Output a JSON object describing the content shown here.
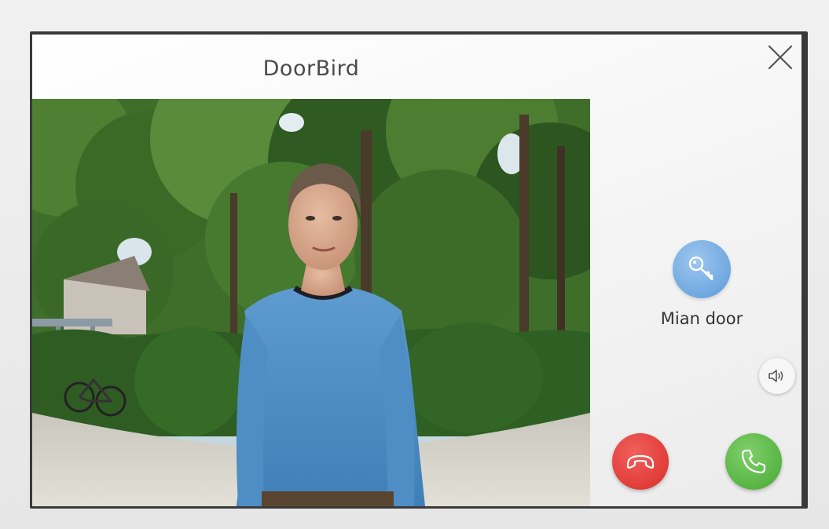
{
  "header": {
    "title": "DoorBird"
  },
  "actions": {
    "door_label": "Mian door"
  },
  "icons": {
    "close": "close-icon",
    "key": "key-icon",
    "speaker": "speaker-icon",
    "hangup": "phone-hangup-icon",
    "answer": "phone-answer-icon"
  },
  "colors": {
    "key_button": "#6fa8e0",
    "hangup_button": "#e03a36",
    "answer_button": "#55b241",
    "title_text": "#4a4a4a"
  }
}
